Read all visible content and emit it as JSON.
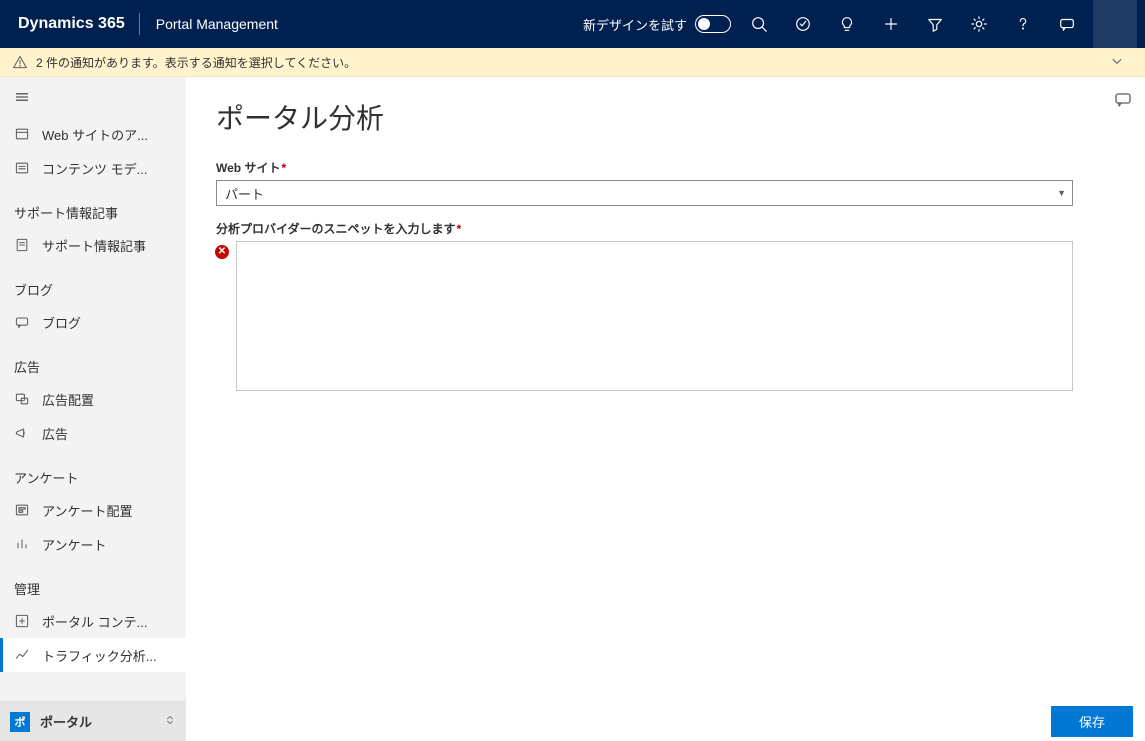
{
  "header": {
    "brand": "Dynamics 365",
    "app_name": "Portal Management",
    "try_new": "新デザインを試す"
  },
  "notification": {
    "text": "2 件の通知があります。表示する通知を選択してください。"
  },
  "sidebar": {
    "top_items": [
      {
        "label": "Web サイトのア..."
      },
      {
        "label": "コンテンツ モデ..."
      }
    ],
    "groups": [
      {
        "header": "サポート情報記事",
        "items": [
          {
            "label": "サポート情報記事"
          }
        ]
      },
      {
        "header": "ブログ",
        "items": [
          {
            "label": "ブログ"
          }
        ]
      },
      {
        "header": "広告",
        "items": [
          {
            "label": "広告配置"
          },
          {
            "label": "広告"
          }
        ]
      },
      {
        "header": "アンケート",
        "items": [
          {
            "label": "アンケート配置"
          },
          {
            "label": "アンケート"
          }
        ]
      },
      {
        "header": "管理",
        "items": [
          {
            "label": "ポータル コンテ..."
          },
          {
            "label": "トラフィック分析...",
            "active": true
          }
        ]
      }
    ],
    "area": {
      "tile": "ポ",
      "label": "ポータル"
    }
  },
  "page": {
    "title": "ポータル分析",
    "website_label": "Web サイト",
    "website_value": "パート",
    "snippet_label": "分析プロバイダーのスニペットを入力します",
    "snippet_value": ""
  },
  "footer": {
    "save": "保存"
  }
}
